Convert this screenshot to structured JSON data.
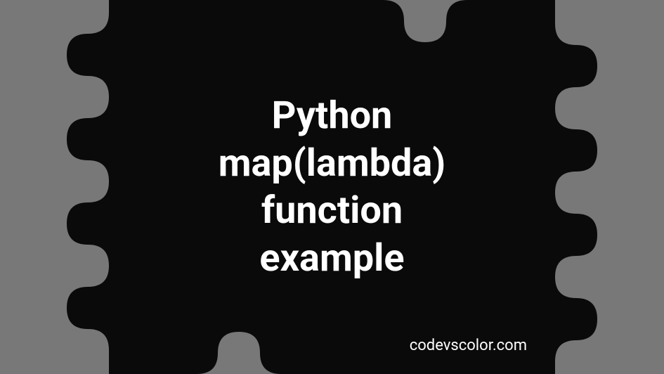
{
  "banner": {
    "title": "Python\nmap(lambda)\nfunction\nexample",
    "watermark": "codevscolor.com"
  },
  "colors": {
    "background_gray": "#787878",
    "shape_black": "#0a0a0a",
    "text": "#ffffff"
  }
}
